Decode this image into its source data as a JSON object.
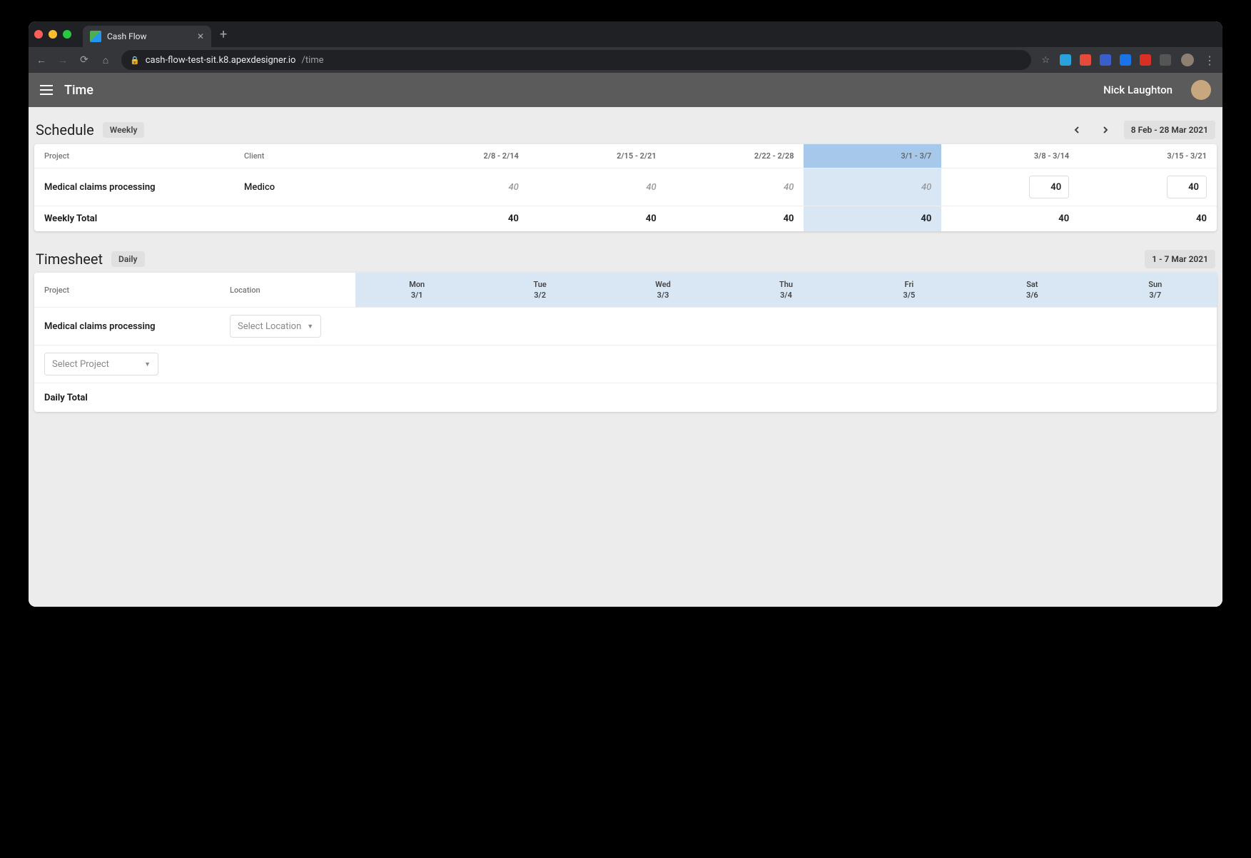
{
  "browser": {
    "tab_title": "Cash Flow",
    "url_host": "cash-flow-test-sit.k8.apexdesigner.io",
    "url_path": "/time"
  },
  "appbar": {
    "title": "Time",
    "user": "Nick Laughton"
  },
  "schedule": {
    "heading": "Schedule",
    "mode": "Weekly",
    "range": "8 Feb - 28 Mar 2021",
    "columns": {
      "project": "Project",
      "client": "Client"
    },
    "weeks": [
      "2/8 - 2/14",
      "2/15 - 2/21",
      "2/22 - 2/28",
      "3/1 - 3/7",
      "3/8 - 3/14",
      "3/15 - 3/21"
    ],
    "highlight_index": 3,
    "rows": [
      {
        "project": "Medical claims processing",
        "client": "Medico",
        "values": [
          "40",
          "40",
          "40",
          "40",
          "40",
          "40"
        ],
        "editable_from": 4
      }
    ],
    "total_label": "Weekly Total",
    "totals": [
      "40",
      "40",
      "40",
      "40",
      "40",
      "40"
    ]
  },
  "timesheet": {
    "heading": "Timesheet",
    "mode": "Daily",
    "range": "1 - 7 Mar 2021",
    "columns": {
      "project": "Project",
      "location": "Location"
    },
    "days": [
      {
        "dow": "Mon",
        "date": "3/1"
      },
      {
        "dow": "Tue",
        "date": "3/2"
      },
      {
        "dow": "Wed",
        "date": "3/3"
      },
      {
        "dow": "Thu",
        "date": "3/4"
      },
      {
        "dow": "Fri",
        "date": "3/5"
      },
      {
        "dow": "Sat",
        "date": "3/6"
      },
      {
        "dow": "Sun",
        "date": "3/7"
      }
    ],
    "rows": [
      {
        "project": "Medical claims processing",
        "location_placeholder": "Select Location"
      }
    ],
    "project_placeholder": "Select Project",
    "total_label": "Daily Total"
  },
  "ext_colors": [
    "#2aa3dd",
    "#e44b3a",
    "#3b5fc9",
    "#1a73e8",
    "#d93025",
    "#555555"
  ]
}
